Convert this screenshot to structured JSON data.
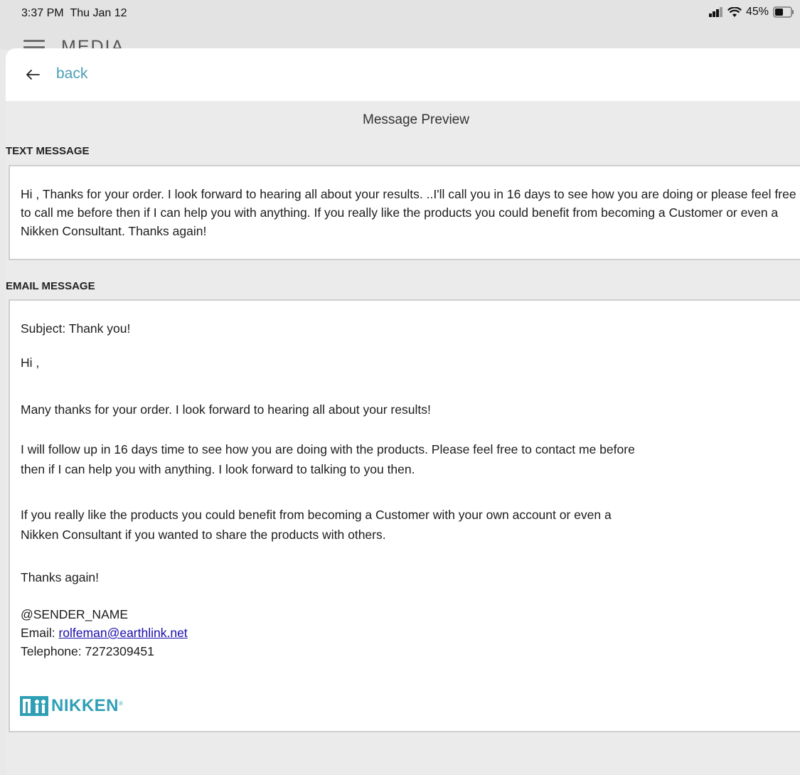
{
  "status": {
    "time": "3:37 PM",
    "date": "Thu Jan 12",
    "battery": "45%",
    "icons": [
      "signal-icon",
      "wifi-icon",
      "battery-icon"
    ]
  },
  "background_header": {
    "title": "MEDIA",
    "menu_icon": "hamburger-menu-icon"
  },
  "nav": {
    "back_icon": "arrow-left-icon",
    "back_label": "back",
    "accent_color": "#4a9eb3"
  },
  "preview": {
    "title": "Message Preview"
  },
  "text_message": {
    "label": "TEXT MESSAGE",
    "body": "Hi , Thanks for your order. I look forward to hearing all about your results. ..I'll call you in 16 days to see how you are doing or please feel free to call me before then if I can help you with anything. If you really like the products you could benefit from becoming a Customer or even a Nikken Consultant. Thanks again!"
  },
  "email_message": {
    "label": "EMAIL MESSAGE",
    "subject": "Subject: Thank you!",
    "greeting": "Hi ,",
    "para1": "Many thanks for your order. I look forward to hearing all about your results!",
    "para2_line1": "I will follow up in 16 days time to see how you are doing with the products. Please feel free to contact me before",
    "para2_line2": "then if I can help you with anything. I look forward to talking to you then.",
    "para3_line1": "If you really like the products you could benefit from becoming a Customer with your own account or even a",
    "para3_line2": "Nikken Consultant if you wanted to share the products with others.",
    "closing": "Thanks again!",
    "sender": "@SENDER_NAME",
    "email_label": "Email: ",
    "email_address": "rolfeman@earthlink.net",
    "telephone": "Telephone: 7272309451",
    "logo_text": "NIKKEN",
    "logo_mark": "®",
    "logo_color": "#2f9fb6"
  }
}
